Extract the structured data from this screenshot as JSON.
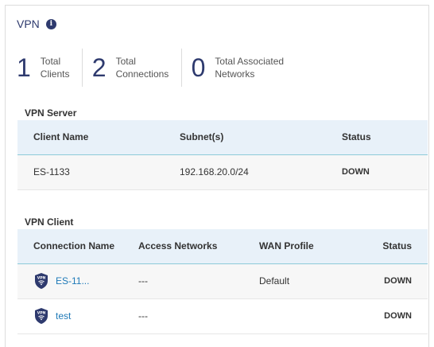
{
  "card": {
    "title": "VPN"
  },
  "stats": [
    {
      "value": "1",
      "label": "Total Clients"
    },
    {
      "value": "2",
      "label": "Total Connections"
    },
    {
      "value": "0",
      "label": "Total Associated Networks"
    }
  ],
  "vpn_server": {
    "title": "VPN Server",
    "columns": [
      "Client Name",
      "Subnet(s)",
      "Status"
    ],
    "rows": [
      {
        "client_name": "ES-1133",
        "subnets": "192.168.20.0/24",
        "status": "DOWN"
      }
    ]
  },
  "vpn_client": {
    "title": "VPN Client",
    "columns": [
      "Connection Name",
      "Access Networks",
      "WAN Profile",
      "Status"
    ],
    "rows": [
      {
        "connection_name": "ES-11...",
        "access_networks": "---",
        "wan_profile": "Default",
        "status": "DOWN",
        "icon": "vpn-shield-icon"
      },
      {
        "connection_name": "test",
        "access_networks": "---",
        "wan_profile": "",
        "status": "DOWN",
        "icon": "vpn-shield-icon"
      }
    ],
    "icon_text": "VPN"
  },
  "colors": {
    "accent": "#2e3a6e",
    "link": "#1f7ab8",
    "status_down": "#c00000",
    "header_bg": "#e8f1f9"
  }
}
